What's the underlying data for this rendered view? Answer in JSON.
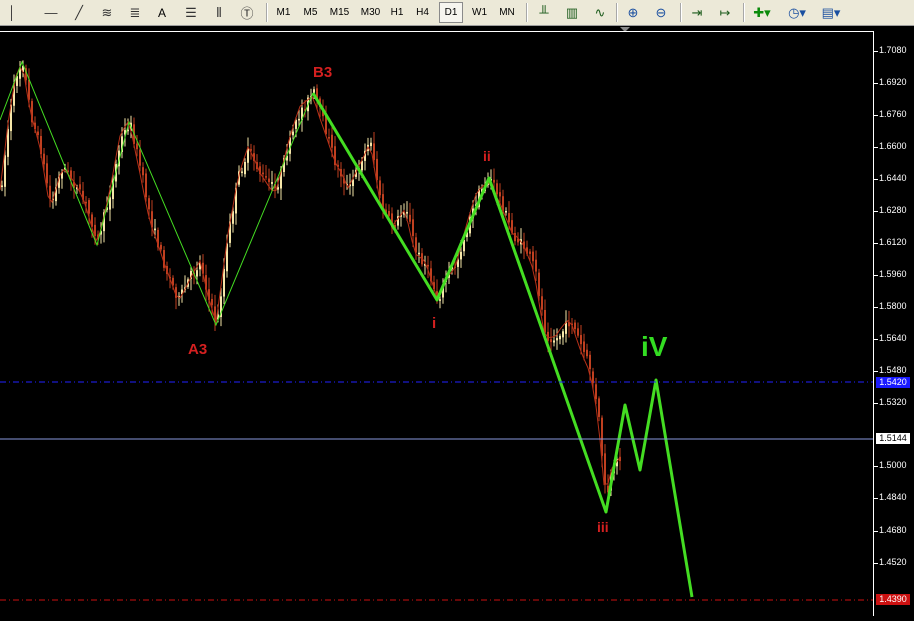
{
  "toolbar": {
    "timeframes": [
      "M1",
      "M5",
      "M15",
      "M30",
      "H1",
      "H4",
      "D1",
      "W1",
      "MN"
    ],
    "active_timeframe": "D1",
    "text_tool_label": "A",
    "icons": [
      "vertical-line-icon",
      "horizontal-line-icon",
      "trendline-icon",
      "fibonacci-expansion-icon",
      "fibonacci-fan-icon",
      "text-icon",
      "fibonacci-retracement-icon",
      "fibonacci-time-icon",
      "text-label-icon",
      "bar-chart-icon",
      "candlestick-icon",
      "line-chart-icon",
      "zoom-in-icon",
      "zoom-out-icon",
      "chart-shift-icon",
      "autoscroll-icon",
      "indicators-icon",
      "periodicity-icon",
      "templates-icon"
    ]
  },
  "price_axis": {
    "ticks": [
      "1.7080",
      "1.6920",
      "1.6760",
      "1.6600",
      "1.6440",
      "1.6280",
      "1.6120",
      "1.5960",
      "1.5800",
      "1.5640",
      "1.5480",
      "1.5320",
      "1.5000",
      "1.4840",
      "1.4680",
      "1.4520"
    ],
    "current_price": "1.5144",
    "blue_level_tag": "1.5420",
    "red_level_tag": "1.4390"
  },
  "wave_labels": {
    "a3": "A3",
    "b3": "B3",
    "i": "i",
    "ii": "ii",
    "iii": "iii",
    "iv": "iV"
  },
  "colors": {
    "background": "#000000",
    "candle_bull": "#f5e6a8",
    "candle_bear": "#c04020",
    "zigzag": "#44dd22",
    "wave_label_red": "#d42020",
    "wave_label_green": "#33dd22",
    "blue_level": "#2222ff",
    "red_level": "#cc1111",
    "current_price_line": "#8899dd"
  }
}
